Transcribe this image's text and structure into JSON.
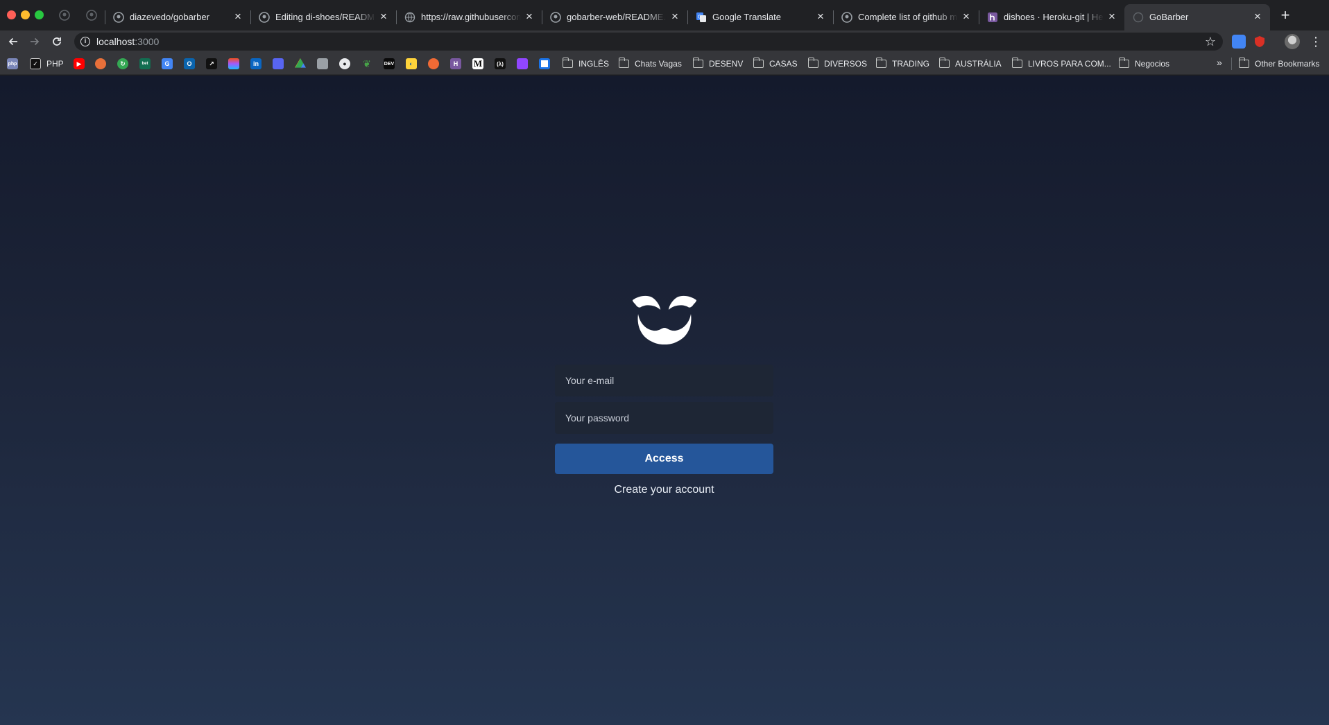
{
  "browser": {
    "tabs": [
      {
        "title": "",
        "icon": "github-icon",
        "pinned": true
      },
      {
        "title": "",
        "icon": "github-icon",
        "pinned": true
      },
      {
        "title": "diazevedo/gobarber",
        "icon": "github-icon",
        "active": false
      },
      {
        "title": "Editing di-shoes/README.md",
        "icon": "github-icon",
        "active": false
      },
      {
        "title": "https://raw.githubusercontent.com",
        "icon": "globe-icon",
        "active": false
      },
      {
        "title": "gobarber-web/README.md",
        "icon": "github-icon",
        "active": false
      },
      {
        "title": "Google Translate",
        "icon": "google-translate-icon",
        "active": false
      },
      {
        "title": "Complete list of github markdown",
        "icon": "github-icon",
        "active": false
      },
      {
        "title": "dishoes · Heroku-git | Heroku",
        "icon": "heroku-icon",
        "active": false
      },
      {
        "title": "GoBarber",
        "icon": "gobarber-icon",
        "active": true
      }
    ],
    "address": {
      "host": "localhost",
      "port": ":3000"
    },
    "bookmarks": {
      "items": [
        {
          "label": "",
          "icon": "php-site-icon",
          "color": "#7a86b8"
        },
        {
          "label": "PHP",
          "icon": "checkbox-icon",
          "color": "#111111"
        },
        {
          "label": "",
          "icon": "youtube-icon",
          "color": "#ff0000"
        },
        {
          "label": "",
          "icon": "feather-icon",
          "color": "#e8703a"
        },
        {
          "label": "",
          "icon": "refresh-green-icon",
          "color": "#34a853"
        },
        {
          "label": "",
          "icon": "bet365-icon",
          "color": "#126e51"
        },
        {
          "label": "",
          "icon": "google-translate-icon",
          "color": "#4285f4"
        },
        {
          "label": "",
          "icon": "outlook-icon",
          "color": "#0a64ad"
        },
        {
          "label": "",
          "icon": "arrow-app-icon",
          "color": "#111111"
        },
        {
          "label": "",
          "icon": "figma-icon",
          "color": "#f24e1e"
        },
        {
          "label": "",
          "icon": "linkedin-icon",
          "color": "#0a66c2"
        },
        {
          "label": "",
          "icon": "discord-icon",
          "color": "#5865f2"
        },
        {
          "label": "",
          "icon": "google-drive-icon",
          "color": "#34a853"
        },
        {
          "label": "",
          "icon": "calendar-icon",
          "color": "#9aa0a6"
        },
        {
          "label": "",
          "icon": "github-icon",
          "color": "#e8eaed"
        },
        {
          "label": "",
          "icon": "mongodb-leaf-icon",
          "color": "#47a248"
        },
        {
          "label": "",
          "icon": "dev-to-icon",
          "color": "#0a0a0a"
        },
        {
          "label": "",
          "icon": "python-icon",
          "color": "#ffd43b"
        },
        {
          "label": "",
          "icon": "basketball-icon",
          "color": "#f06a35"
        },
        {
          "label": "",
          "icon": "heroku-icon",
          "color": "#79589f"
        },
        {
          "label": "",
          "icon": "medium-icon",
          "color": "#000000"
        },
        {
          "label": "",
          "icon": "lambda-icon",
          "color": "#111111"
        },
        {
          "label": "",
          "icon": "twitch-icon",
          "color": "#9146ff"
        },
        {
          "label": "",
          "icon": "screen-icon",
          "color": "#1a73e8"
        }
      ],
      "folders": [
        "INGLÊS",
        "Chats Vagas",
        "DESENV",
        "CASAS",
        "DIVERSOS",
        "TRADING",
        "AUSTRÁLIA",
        "LIVROS PARA COM...",
        "Negocios"
      ],
      "other": "Other Bookmarks"
    }
  },
  "login": {
    "email_placeholder": "Your e-mail",
    "password_placeholder": "Your password",
    "access_label": "Access",
    "create_account_label": "Create your account"
  },
  "colors": {
    "page_top": "#141a2c",
    "page_bottom": "#253550",
    "input_bg": "#1e2635",
    "button": "#25569a"
  }
}
